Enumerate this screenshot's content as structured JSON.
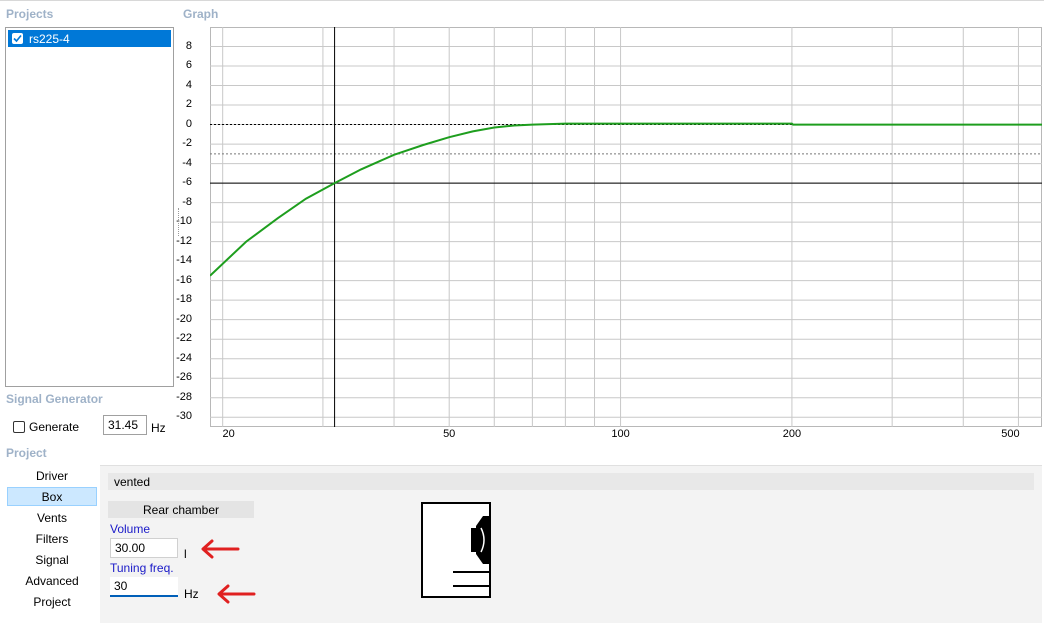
{
  "panels": {
    "projects_title": "Projects",
    "graph_title": "Graph",
    "signal_generator_title": "Signal Generator",
    "project_title": "Project"
  },
  "projects": [
    {
      "name": "rs225-4",
      "checked": true
    }
  ],
  "signal_generator": {
    "generate_label": "Generate",
    "generate_checked": false,
    "frequency": "31.45",
    "unit": "Hz"
  },
  "graph": {
    "y_ticks": [
      "8",
      "6",
      "4",
      "2",
      "0",
      "-2",
      "-4",
      "-6",
      "-8",
      "-10",
      "-12",
      "-14",
      "-16",
      "-18",
      "-20",
      "-22",
      "-24",
      "-26",
      "-28",
      "-30"
    ],
    "x_ticks": [
      "20",
      "50",
      "100",
      "200",
      "500"
    ],
    "line_color": "#1e9e1e"
  },
  "chart_data": {
    "type": "line",
    "x_scale": "log",
    "xlim": [
      19,
      550
    ],
    "ylim": [
      -31,
      10
    ],
    "grid": true,
    "reference_lines": {
      "dashed_black_y": 0,
      "dashed_gray_y": -3,
      "solid_black_y": -6,
      "cursor_x": 31.45
    },
    "series": [
      {
        "x": [
          19,
          22,
          25,
          28,
          31.45,
          35,
          40,
          45,
          50,
          55,
          60,
          65,
          70,
          80,
          100,
          140,
          200,
          201,
          300,
          550
        ],
        "y": [
          -15.5,
          -12.0,
          -9.6,
          -7.6,
          -6.0,
          -4.6,
          -3.1,
          -2.1,
          -1.3,
          -0.7,
          -0.3,
          -0.1,
          0.0,
          0.1,
          0.1,
          0.1,
          0.1,
          0.0,
          0.0,
          0.0
        ]
      }
    ]
  },
  "nav": {
    "items": [
      "Driver",
      "Box",
      "Vents",
      "Filters",
      "Signal",
      "Advanced",
      "Project"
    ],
    "selected": "Box"
  },
  "box": {
    "type": "vented",
    "rear_chamber_label": "Rear chamber",
    "volume_label": "Volume",
    "volume_value": "30.00",
    "volume_unit": "l",
    "tuning_label": "Tuning freq.",
    "tuning_value": "30",
    "tuning_unit": "Hz"
  },
  "colors": {
    "section_title": "#9fb2c8",
    "selection": "#0078d7",
    "nav_selected": "#cce8ff",
    "field_label": "#1a1ac8",
    "annotation_arrow": "#e02020"
  }
}
